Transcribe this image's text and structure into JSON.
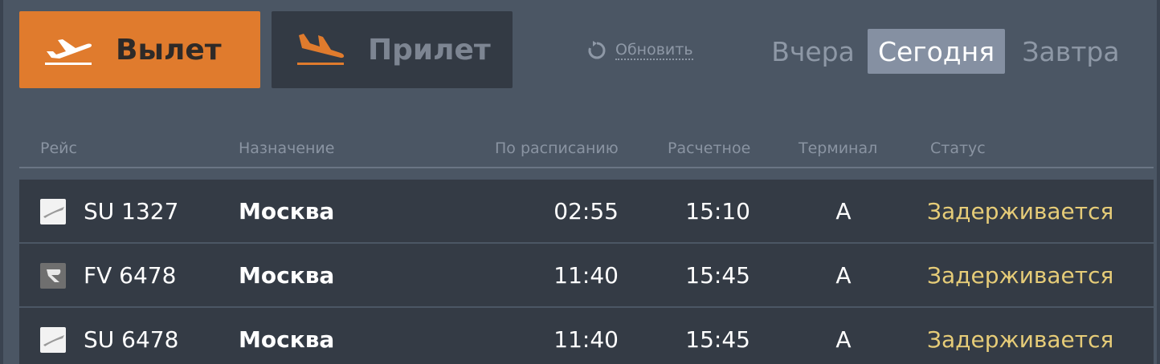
{
  "tabs": {
    "departure_label": "Вылет",
    "arrival_label": "Прилет"
  },
  "refresh": {
    "label": "Обновить"
  },
  "days": {
    "yesterday": "Вчера",
    "today": "Сегодня",
    "tomorrow": "Завтра",
    "selected": "Сегодня"
  },
  "table": {
    "headers": {
      "flight": "Рейс",
      "destination": "Назначение",
      "scheduled": "По расписанию",
      "estimated": "Расчетное",
      "terminal": "Терминал",
      "status": "Статус"
    },
    "rows": [
      {
        "airline_logo": "su-logo-icon",
        "flight": "SU 1327",
        "destination": "Москва",
        "scheduled": "02:55",
        "estimated": "15:10",
        "terminal": "A",
        "status": "Задерживается"
      },
      {
        "airline_logo": "fv-logo-icon",
        "flight": "FV 6478",
        "destination": "Москва",
        "scheduled": "11:40",
        "estimated": "15:45",
        "terminal": "A",
        "status": "Задерживается"
      },
      {
        "airline_logo": "su-logo-icon",
        "flight": "SU 6478",
        "destination": "Москва",
        "scheduled": "11:40",
        "estimated": "15:45",
        "terminal": "A",
        "status": "Задерживается"
      }
    ]
  },
  "colors": {
    "accent": "#e07b2d",
    "background": "#4b5664",
    "row_background": "#343b45",
    "status_delayed": "#e6cc78",
    "selected_day": "#8590a2"
  }
}
